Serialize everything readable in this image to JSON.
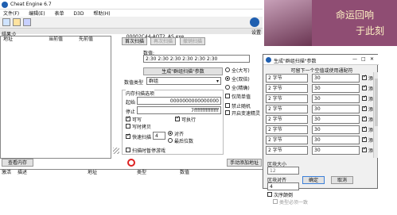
{
  "app": {
    "title": "Cheat Engine 6.7",
    "process_title": "00002C44-AOT2_AS.exe",
    "settings_label": "设置"
  },
  "menu": [
    "文件(F)",
    "编辑(E)",
    "表单",
    "D3D",
    "帮助(H)"
  ],
  "found_label": "结果:0",
  "results_columns": [
    "地址",
    "当前值",
    "先前值"
  ],
  "buttons": {
    "first_scan": "首次扫描",
    "next_scan": "再次扫描",
    "undo_scan": "撤销扫描",
    "generate_group": "生成\"群组扫描\"参数",
    "view_memory": "查看内存",
    "manual_add": "手动添加地址"
  },
  "scan": {
    "value_label": "数值:",
    "value": "2:30 2:30 2:30 2:30 2:30 2:30",
    "scan_type_label": "数值类型",
    "scan_type_value": "群组",
    "mem_options_label": "内存扫描选项",
    "start_label": "起始",
    "start_value": "0000000000000000",
    "stop_label": "停止",
    "stop_value": "7fffffffffffffff",
    "writable": "可写",
    "executable": "可执行",
    "copy_on_write": "写时拷贝",
    "fast_scan": "快速扫描",
    "fast_scan_value": "4",
    "align": "对齐",
    "last_digits": "最后位数",
    "pause_game": "扫描时暂停游戏"
  },
  "radio_options": [
    "全(大写)",
    "全(双倍)",
    "全(精确)",
    "仅简单值"
  ],
  "extra_options": [
    "禁止随机",
    "开启变速精灵"
  ],
  "address_columns": [
    "激活",
    "描述",
    "地址",
    "类型",
    "数值"
  ],
  "ad": {
    "headline": "命运回响",
    "sub": "于此刻"
  },
  "dialog": {
    "title": "生成\"群组扫描\"参数",
    "header": "可留下一个空值或使用通配符",
    "rows": [
      {
        "type": "2 字节",
        "value": "30",
        "add": "添加"
      },
      {
        "type": "2 字节",
        "value": "30",
        "add": "添加"
      },
      {
        "type": "2 字节",
        "value": "30",
        "add": "添加"
      },
      {
        "type": "2 字节",
        "value": "30",
        "add": "添加"
      },
      {
        "type": "2 字节",
        "value": "30",
        "add": "添加"
      },
      {
        "type": "2 字节",
        "value": "30",
        "add": "添加"
      },
      {
        "type": "2 字节",
        "value": "30",
        "add": "添加"
      },
      {
        "type": "2 字节",
        "value": "30",
        "add": "添加"
      }
    ],
    "block_size_label": "区块大小",
    "block_size_value": "12",
    "block_align_label": "区块对齐",
    "block_align_value": "4",
    "out_of_order": "次序颠倒",
    "type_must_match": "类型必须一致",
    "ok": "确定",
    "cancel": "取消"
  },
  "colors": {
    "ad_bg": "#8f4d73",
    "ad_text": "#fff3c4",
    "ce_blue": "#1f5fb0"
  }
}
